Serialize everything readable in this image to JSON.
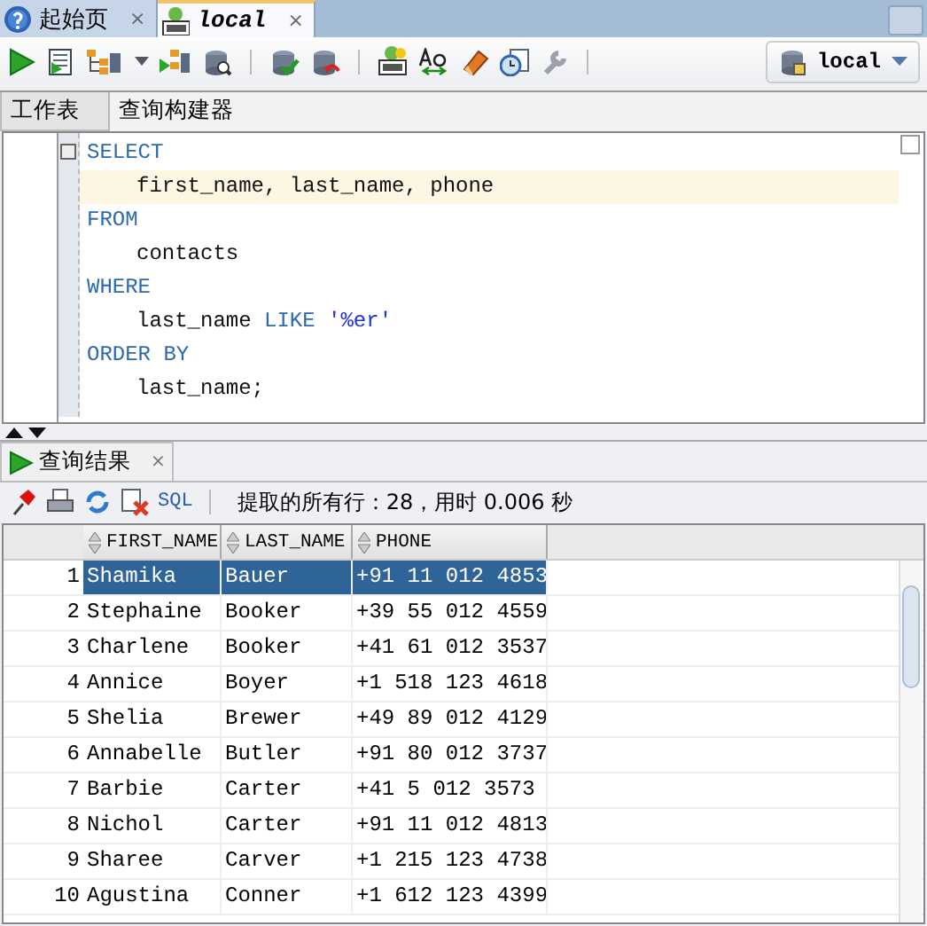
{
  "doc_tabs": [
    {
      "label": "起始页",
      "close": "×",
      "selected": false,
      "kind": "help"
    },
    {
      "label": "local",
      "close": "×",
      "selected": true,
      "kind": "sql"
    }
  ],
  "connection": {
    "label": "local"
  },
  "sub_tabs": [
    {
      "label": "工作表",
      "selected": true
    },
    {
      "label": "查询构建器",
      "selected": false
    }
  ],
  "editor": {
    "lines": [
      {
        "indented": false,
        "current": false,
        "tokens": [
          {
            "kind": "keyword",
            "text": "SELECT"
          }
        ]
      },
      {
        "indented": true,
        "current": true,
        "tokens": [
          {
            "kind": "ident",
            "text": "first_name, last_name, phone"
          }
        ]
      },
      {
        "indented": false,
        "current": false,
        "tokens": [
          {
            "kind": "keyword",
            "text": "FROM"
          }
        ]
      },
      {
        "indented": true,
        "current": false,
        "tokens": [
          {
            "kind": "ident",
            "text": "contacts"
          }
        ]
      },
      {
        "indented": false,
        "current": false,
        "tokens": [
          {
            "kind": "keyword",
            "text": "WHERE"
          }
        ]
      },
      {
        "indented": true,
        "current": false,
        "tokens": [
          {
            "kind": "ident",
            "text": "last_name "
          },
          {
            "kind": "keyword",
            "text": "LIKE "
          },
          {
            "kind": "string",
            "text": "'%er'"
          }
        ]
      },
      {
        "indented": false,
        "current": false,
        "tokens": [
          {
            "kind": "keyword",
            "text": "ORDER BY"
          }
        ]
      },
      {
        "indented": true,
        "current": false,
        "tokens": [
          {
            "kind": "ident",
            "text": "last_name;"
          }
        ]
      }
    ]
  },
  "results": {
    "tab": {
      "label": "查询结果",
      "close": "×",
      "selected": true
    },
    "sql_link": "SQL",
    "status": "提取的所有行：28，用时 0.006 秒",
    "columns": [
      "FIRST_NAME",
      "LAST_NAME",
      "PHONE"
    ],
    "rows": [
      {
        "num": "1",
        "cells": [
          "Shamika",
          "Bauer",
          "+91 11 012 4853"
        ],
        "selected": true
      },
      {
        "num": "2",
        "cells": [
          "Stephaine",
          "Booker",
          "+39 55 012 4559"
        ],
        "selected": false
      },
      {
        "num": "3",
        "cells": [
          "Charlene",
          "Booker",
          "+41 61 012 3537"
        ],
        "selected": false
      },
      {
        "num": "4",
        "cells": [
          "Annice",
          "Boyer",
          "+1 518 123 4618"
        ],
        "selected": false
      },
      {
        "num": "5",
        "cells": [
          "Shelia",
          "Brewer",
          "+49 89 012 4129"
        ],
        "selected": false
      },
      {
        "num": "6",
        "cells": [
          "Annabelle",
          "Butler",
          "+91 80 012 3737"
        ],
        "selected": false
      },
      {
        "num": "7",
        "cells": [
          "Barbie",
          "Carter",
          "+41 5 012 3573"
        ],
        "selected": false
      },
      {
        "num": "8",
        "cells": [
          "Nichol",
          "Carter",
          "+91 11 012 4813"
        ],
        "selected": false
      },
      {
        "num": "9",
        "cells": [
          "Sharee",
          "Carver",
          "+1 215 123 4738"
        ],
        "selected": false
      },
      {
        "num": "10",
        "cells": [
          "Agustina",
          "Conner",
          "+1 612 123 4399"
        ],
        "selected": false
      }
    ]
  }
}
